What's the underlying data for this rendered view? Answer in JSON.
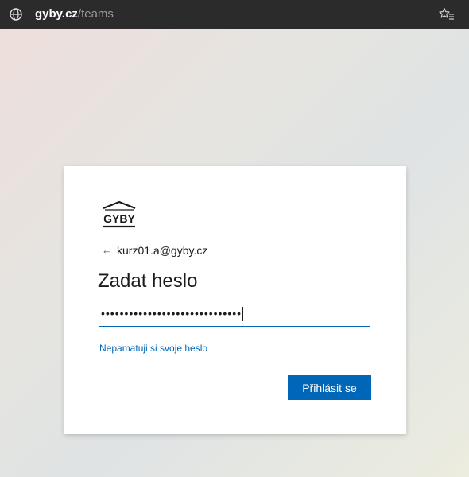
{
  "browser": {
    "url_host": "gyby.cz",
    "url_path": "/teams",
    "site_icon": "globe-icon",
    "favorites_icon": "favorites-icon"
  },
  "signin": {
    "logo_text": "GYBY",
    "back_icon": "back-arrow-icon",
    "account": "kurz01.a@gyby.cz",
    "title": "Zadat heslo",
    "password_masked": "••••••••••••••••••••••••••••••",
    "forgot_link": "Nepamatuji si svoje heslo",
    "submit_label": "Přihlásit se"
  },
  "colors": {
    "accent": "#0067b8",
    "addressbar_bg": "#2b2b2b"
  }
}
